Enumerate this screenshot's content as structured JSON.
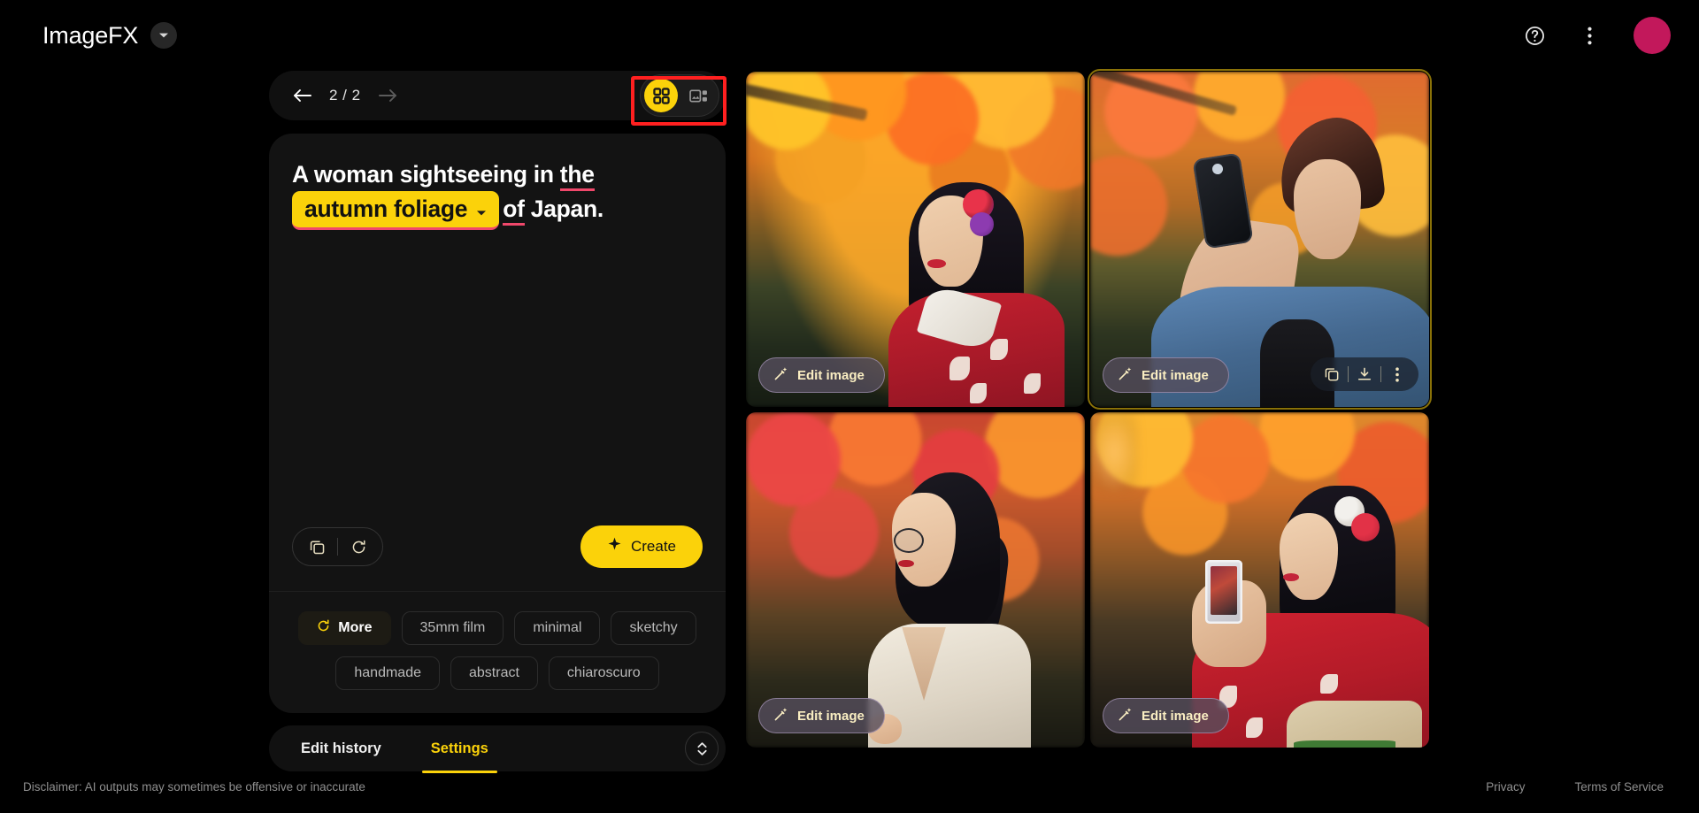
{
  "header": {
    "brand_title": "ImageFX",
    "brand_chevron_icon": "chevron-down-icon",
    "help_icon": "help-circle-icon",
    "more_icon": "more-vertical-icon",
    "avatar_label": "",
    "avatar_color": "#c2185b"
  },
  "nav": {
    "back_icon": "arrow-left-icon",
    "forward_icon": "arrow-right-icon",
    "counter": "2 / 2",
    "views": [
      {
        "name": "grid-view",
        "icon": "grid-2x2-icon",
        "active": true
      },
      {
        "name": "detail-view",
        "icon": "image-list-icon",
        "active": false
      }
    ]
  },
  "prompt": {
    "segment_1": "A woman sightseeing in ",
    "segment_the": "the",
    "chip_label": "autumn foliage",
    "chip_caret_icon": "caret-down-icon",
    "segment_of": "of",
    "segment_last": " Japan.",
    "chip_bg": "#fbd20a",
    "underline_color": "#f0486b"
  },
  "prompt_actions": {
    "copy_icon": "copy-icon",
    "reset_icon": "reset-icon",
    "create_label": "Create",
    "create_icon": "sparkle-icon",
    "create_bg": "#fbd20a"
  },
  "style_chips": {
    "rows": [
      [
        {
          "label": "More",
          "icon": "refresh-icon",
          "primary": true
        },
        {
          "label": "35mm film",
          "icon": "",
          "primary": false
        },
        {
          "label": "minimal",
          "icon": "",
          "primary": false
        },
        {
          "label": "sketchy",
          "icon": "",
          "primary": false
        }
      ],
      [
        {
          "label": "handmade",
          "icon": "",
          "primary": false
        },
        {
          "label": "abstract",
          "icon": "",
          "primary": false
        },
        {
          "label": "chiaroscuro",
          "icon": "",
          "primary": false
        }
      ]
    ]
  },
  "tabs": {
    "items": [
      {
        "label": "Edit history",
        "active": false
      },
      {
        "label": "Settings",
        "active": true
      }
    ],
    "expand_icon": "expand-collapse-icon",
    "active_color": "#fbd20a"
  },
  "grid": {
    "edit_label": "Edit image",
    "edit_icon": "magic-wand-icon",
    "tiles": [
      {
        "alt": "Smiling woman in red floral kimono before golden autumn maple canopy",
        "selected": false,
        "show_tools": false
      },
      {
        "alt": "Woman with short spiky hair taking a selfie in a denim jacket under red maple leaves",
        "selected": true,
        "show_tools": true
      },
      {
        "alt": "Woman with glasses and ponytail in cream cardigan walking past crimson foliage",
        "selected": false,
        "show_tools": false
      },
      {
        "alt": "Woman in red kimono with hair flowers photographing autumn leaves with a phone",
        "selected": false,
        "show_tools": false
      }
    ],
    "tools": [
      {
        "name": "copy-icon"
      },
      {
        "name": "download-icon"
      },
      {
        "name": "more-vertical-icon"
      }
    ]
  },
  "footer": {
    "disclaimer": "Disclaimer: AI outputs may sometimes be offensive or inaccurate",
    "privacy": "Privacy",
    "terms": "Terms of Service"
  }
}
